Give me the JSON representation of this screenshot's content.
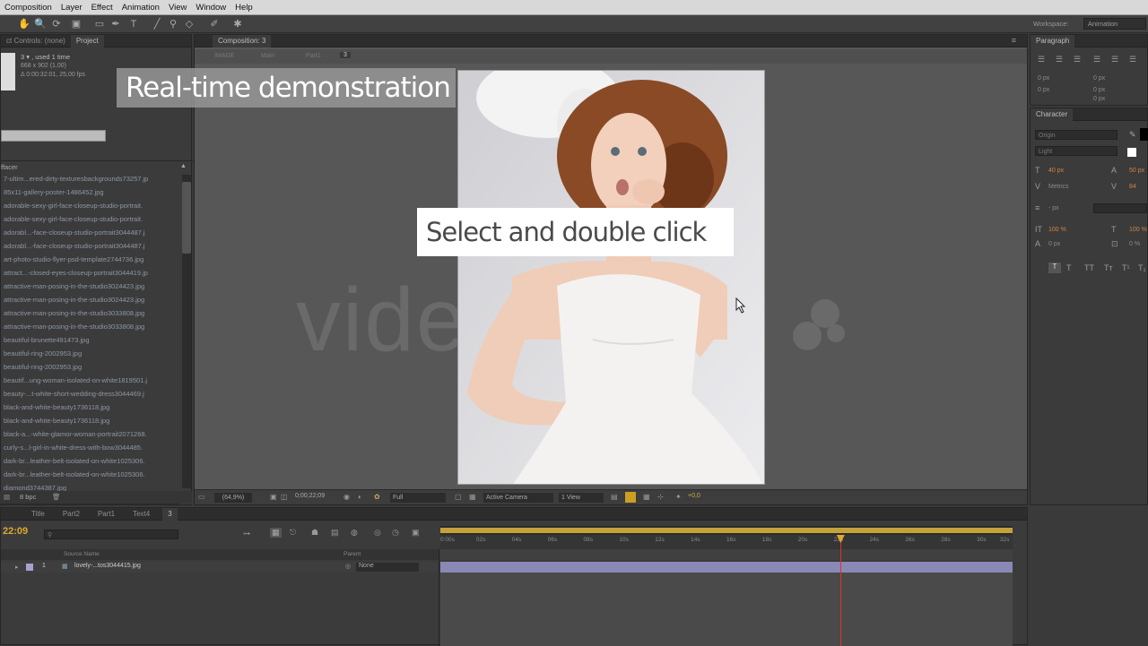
{
  "menubar": {
    "items": [
      "Composition",
      "Layer",
      "Effect",
      "Animation",
      "View",
      "Window",
      "Help"
    ]
  },
  "workspace": {
    "label": "Workspace:",
    "value": "Animation"
  },
  "left_panel": {
    "tabs": [
      "ct Controls: (none)",
      "Project"
    ],
    "item_info": [
      "3 ▾ , used 1 time",
      "668 x 902 (1,00)",
      "Δ 0:00:32:01, 25,00 fps"
    ],
    "folder": "ffacer",
    "files": [
      "7-ultim...ered-dirty-texturesbackgrounds73257.jp",
      "85x11-gallery-poster-1486452.jpg",
      "adorable-sexy-girl-face-closeup-studio-portrait.",
      "adorable-sexy-girl-face-closeup-studio-portrait.",
      "adorabl...-face-closeup-studio-portrait3044487.j",
      "adorabl...-face-closeup-studio-portrait3044487.j",
      "art-photo-studio-flyer-psd-template2744736.jpg",
      "attract...-closed-eyes-closeup-portrait3044419.jp",
      "attractive-man-posing-in-the-studio3024423.jpg",
      "attractive-man-posing-in-the-studio3024423.jpg",
      "attractive-man-posing-in-the-studio3033808.jpg",
      "attractive-man-posing-in-the-studio3033808.jpg",
      "beautiful-brunette491473.jpg",
      "beautiful-ring-2002953.jpg",
      "beautiful-ring-2002953.jpg",
      "beautif...ung-woman-isolated-on-white1819501.j",
      "beauty-...t-white-short-wedding-dress3044469.j",
      "black-and-white-beauty1736118.jpg",
      "black-and-white-beauty1736118.jpg",
      "black-a...-white-glamor-woman-portrait2071268.",
      "curly-s...l-girl-in-white-dress-with-bow3044485.",
      "dark-br...leather-belt-isolated-on-white1025306.",
      "dark-br...leather-belt-isolated-on-white1025306.",
      "diamond3744387.jpg"
    ],
    "bpc": "8 bpc"
  },
  "comp_panel": {
    "tab": "Composition: 3",
    "flow": [
      "IMAGE",
      "Main",
      "Part1",
      "3"
    ],
    "zoom": "(64,9%)",
    "timecode": "0;00;22;09",
    "resolution": "Full",
    "camera": "Active Camera",
    "views": "1 View",
    "exposure": "+0,0"
  },
  "overlays": {
    "caption": "Real-time demonstration",
    "instruction": "Select and double click",
    "watermark": "vide"
  },
  "paragraph_panel": {
    "title": "Paragraph",
    "values": [
      "0 px",
      "0 px",
      "0 px",
      "0 px",
      "0 px"
    ]
  },
  "character_panel": {
    "title": "Character",
    "font": "Origin",
    "style": "Light",
    "size": "40 px",
    "leading": "50 px",
    "kerning": "Metrics",
    "tracking": "84",
    "stroke": "- px",
    "vscale": "100 %",
    "hscale": "100 %",
    "baseline": "0 px",
    "tsume": "0 %"
  },
  "timeline": {
    "tabs": [
      "Title",
      "Part2",
      "Part1",
      "Text4",
      "3"
    ],
    "timecode": "22:09",
    "column_source": "Source Name",
    "column_parent": "Parent",
    "layer": {
      "num": "1",
      "name": "lovely-...tos3044415.jpg",
      "parent": "None"
    },
    "ticks": [
      "0:00s",
      "02s",
      "04s",
      "06s",
      "08s",
      "10s",
      "12s",
      "14s",
      "16s",
      "18s",
      "20s",
      "22s",
      "24s",
      "26s",
      "28s",
      "30s",
      "32s"
    ],
    "playhead_seconds": 22.36,
    "duration_seconds": 32
  },
  "colors": {
    "accent": "#e0a82e",
    "layer_bar": "#8a88b5",
    "playhead": "#e03030"
  }
}
